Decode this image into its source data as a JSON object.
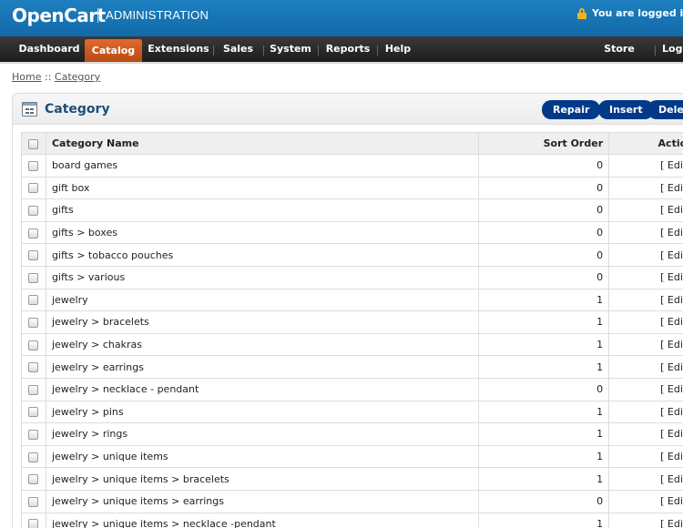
{
  "header": {
    "logo": "OpenCart",
    "subtitle": "ADMINISTRATION",
    "logged_in": "You are logged in as a"
  },
  "menu": {
    "items": [
      "Dashboard",
      "Catalog",
      "Extensions",
      "Sales",
      "System",
      "Reports",
      "Help"
    ],
    "active": "Catalog",
    "store_front": "Store Front",
    "logout": "Log"
  },
  "breadcrumb": {
    "home": "Home",
    "separator": "::",
    "current": "Category"
  },
  "box": {
    "title": "Category",
    "buttons": {
      "repair": "Repair",
      "insert": "Insert",
      "delete": "Delete"
    }
  },
  "table": {
    "columns": {
      "name": "Category Name",
      "sort": "Sort Order",
      "action": "Action"
    },
    "action_label": "[ Edit ]",
    "rows": [
      {
        "name": "board games",
        "sort": "0"
      },
      {
        "name": "gift box",
        "sort": "0"
      },
      {
        "name": "gifts",
        "sort": "0"
      },
      {
        "name": "gifts > boxes",
        "sort": "0"
      },
      {
        "name": "gifts > tobacco pouches",
        "sort": "0"
      },
      {
        "name": "gifts > various",
        "sort": "0"
      },
      {
        "name": "jewelry",
        "sort": "1"
      },
      {
        "name": "jewelry > bracelets",
        "sort": "1"
      },
      {
        "name": "jewelry > chakras",
        "sort": "1"
      },
      {
        "name": "jewelry > earrings",
        "sort": "1"
      },
      {
        "name": "jewelry > necklace - pendant",
        "sort": "0"
      },
      {
        "name": "jewelry > pins",
        "sort": "1"
      },
      {
        "name": "jewelry > rings",
        "sort": "1"
      },
      {
        "name": "jewelry > unique items",
        "sort": "1"
      },
      {
        "name": "jewelry > unique items > bracelets",
        "sort": "1"
      },
      {
        "name": "jewelry > unique items > earrings",
        "sort": "0"
      },
      {
        "name": "jewelry > unique items > necklace -pendant",
        "sort": "1"
      }
    ]
  }
}
